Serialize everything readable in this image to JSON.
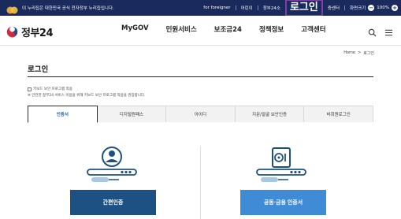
{
  "gov_banner": {
    "text": "이 누리집은 대한민국 공식 전자정부 누리집입니다.",
    "utility": {
      "foreigner": "for foreigner",
      "kids": "어린이",
      "gov24_short": "정부24소",
      "login": "로그인",
      "cert_center": "증센터",
      "zoom_label": "화면크기",
      "zoom_minus": "−",
      "zoom_value": "100%",
      "zoom_plus": "+"
    }
  },
  "header": {
    "logo_text": "정부24",
    "nav": [
      "MyGOV",
      "민원서비스",
      "보조금24",
      "정책정보",
      "고객센터"
    ]
  },
  "breadcrumb": {
    "home": "Home",
    "sep": ">",
    "current": "로그인"
  },
  "page": {
    "title": "로그인",
    "checkbox_label": "키보드 보안 프로그램 적용",
    "note": "※ 안전한 정부24 서비스 이용을 위해 키보드 보안 프로그램 적용을 권장합니다."
  },
  "tabs": [
    {
      "label": "인증서",
      "active": true
    },
    {
      "label": "디지털원패스",
      "active": false
    },
    {
      "label": "아이디",
      "active": false
    },
    {
      "label": "지문/얼굴 보안인증",
      "active": false
    },
    {
      "label": "비회원로그인",
      "active": false
    }
  ],
  "panels": {
    "left_button": "간편인증",
    "right_button": "공동·금융 인증서"
  },
  "colors": {
    "banner_bg": "#1b2a5c",
    "login_highlight": "#7b3fa8",
    "active_tab_text": "#1e5fa5",
    "left_button": "#1e5183",
    "right_button": "#3f8bd6"
  },
  "icons": [
    "gov-flag-icon",
    "government-emblem-icon",
    "search-icon",
    "menu-icon",
    "simple-auth-icon",
    "certificate-auth-icon"
  ]
}
